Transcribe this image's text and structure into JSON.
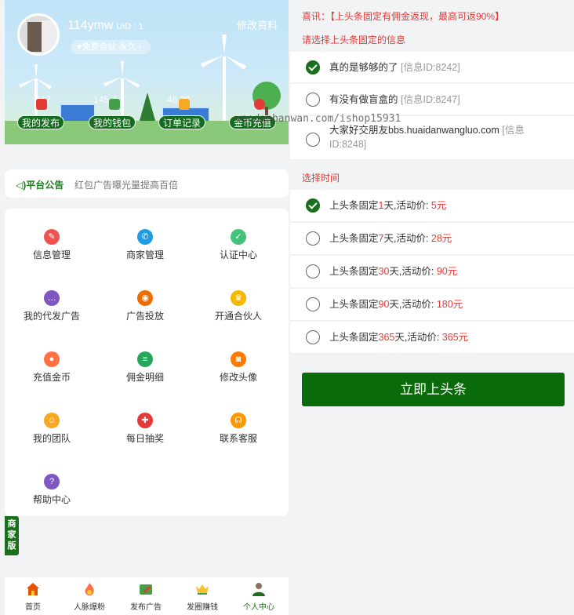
{
  "profile": {
    "username": "114ymw",
    "uid": "UID : 1",
    "partner_badge": "免费合伙 永久",
    "edit_link": "修改资料"
  },
  "banner_stats": [
    "117",
    "145.4",
    "46.26"
  ],
  "banner_chips": [
    "我的发布",
    "我的钱包",
    "订单记录",
    "金币充值"
  ],
  "watermark": "waodanbanwan.com/ishop15931",
  "notice": {
    "title": "平台公告",
    "text": "红包广告曝光量提高百倍"
  },
  "menu": [
    {
      "label": "信息管理",
      "icon": "edit-icon",
      "color": "#ef5350",
      "glyph": "✎"
    },
    {
      "label": "商家管理",
      "icon": "wechat-icon",
      "color": "#1e9be3",
      "glyph": "✆"
    },
    {
      "label": "认证中心",
      "icon": "shield-check-icon",
      "color": "#43c37a",
      "glyph": "✓"
    },
    {
      "label": "我的代发广告",
      "icon": "chat-bubble-icon",
      "color": "#7e57c2",
      "glyph": "…"
    },
    {
      "label": "广告投放",
      "icon": "target-icon",
      "color": "#ef6c00",
      "glyph": "◉"
    },
    {
      "label": "开通合伙人",
      "icon": "crown-icon",
      "color": "#f5b700",
      "glyph": "♛"
    },
    {
      "label": "充值金币",
      "icon": "coins-icon",
      "color": "#ff7043",
      "glyph": "●"
    },
    {
      "label": "佣金明细",
      "icon": "clipboard-icon",
      "color": "#26a65b",
      "glyph": "≡"
    },
    {
      "label": "修改头像",
      "icon": "camera-icon",
      "color": "#ff7a00",
      "glyph": "◙"
    },
    {
      "label": "我的团队",
      "icon": "team-icon",
      "color": "#f9a825",
      "glyph": "☺"
    },
    {
      "label": "每日抽奖",
      "icon": "gift-icon",
      "color": "#e53935",
      "glyph": "✚"
    },
    {
      "label": "联系客服",
      "icon": "headset-icon",
      "color": "#ff9800",
      "glyph": "☊"
    },
    {
      "label": "帮助中心",
      "icon": "help-icon",
      "color": "#7e57c2",
      "glyph": "?"
    }
  ],
  "side_tag": "商家版",
  "tabs": [
    {
      "label": "首页",
      "icon": "home-icon"
    },
    {
      "label": "人脉爆粉",
      "icon": "fire-icon"
    },
    {
      "label": "发布广告",
      "icon": "publish-icon"
    },
    {
      "label": "发圈赚钱",
      "icon": "crown-icon"
    },
    {
      "label": "个人中心",
      "icon": "user-icon"
    }
  ],
  "right": {
    "notice": "喜讯：【上头条固定有佣金返现，最高可返90%】",
    "select_info_title": "请选择上头条固定的信息",
    "infos": [
      {
        "title": "真的是够够的了",
        "id": "[信息ID:8242]",
        "selected": true
      },
      {
        "title": "有没有做盲盒的",
        "id": "[信息ID:8247]",
        "selected": false
      },
      {
        "title": "大家好交朋友bbs.huaidanwangluo.com",
        "id": "[信息ID:8248]",
        "selected": false
      }
    ],
    "select_time_title": "选择时间",
    "time_prefix": "上头条固定",
    "time_mid": "天,活动价: ",
    "time_suffix": "元",
    "times": [
      {
        "days": "1",
        "price": "5",
        "selected": true
      },
      {
        "days": "7",
        "price": "28",
        "selected": false
      },
      {
        "days": "30",
        "price": "90",
        "selected": false
      },
      {
        "days": "90",
        "price": "180",
        "selected": false
      },
      {
        "days": "365",
        "price": "365",
        "selected": false
      }
    ],
    "cta": "立即上头条"
  }
}
